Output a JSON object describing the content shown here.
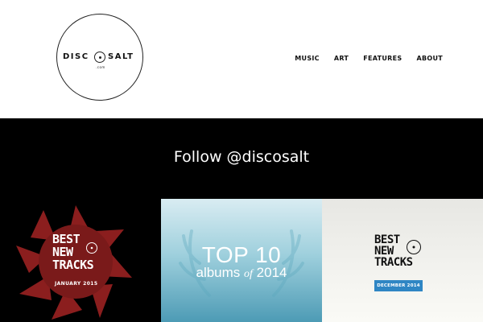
{
  "header": {
    "logo": {
      "left_word": "DISC",
      "right_word": "SALT",
      "suffix": ".com"
    },
    "nav": [
      {
        "label": "MUSIC"
      },
      {
        "label": "ART"
      },
      {
        "label": "FEATURES"
      },
      {
        "label": "ABOUT"
      }
    ]
  },
  "follow": {
    "text": "Follow @discosalt"
  },
  "tiles": [
    {
      "title_lines": [
        "BEST",
        "NEW",
        "TRACKS"
      ],
      "subtitle": "JANUARY 2015",
      "accent": "#8b1e1e"
    },
    {
      "title": "TOP 10",
      "subtitle_pre": "albums",
      "subtitle_of": "of",
      "subtitle_year": "2014",
      "accent": "#4d9bb5"
    },
    {
      "title_lines": [
        "BEST",
        "NEW",
        "TRACKS"
      ],
      "badge": "DECEMBER 2014",
      "accent": "#2f86c4"
    }
  ]
}
